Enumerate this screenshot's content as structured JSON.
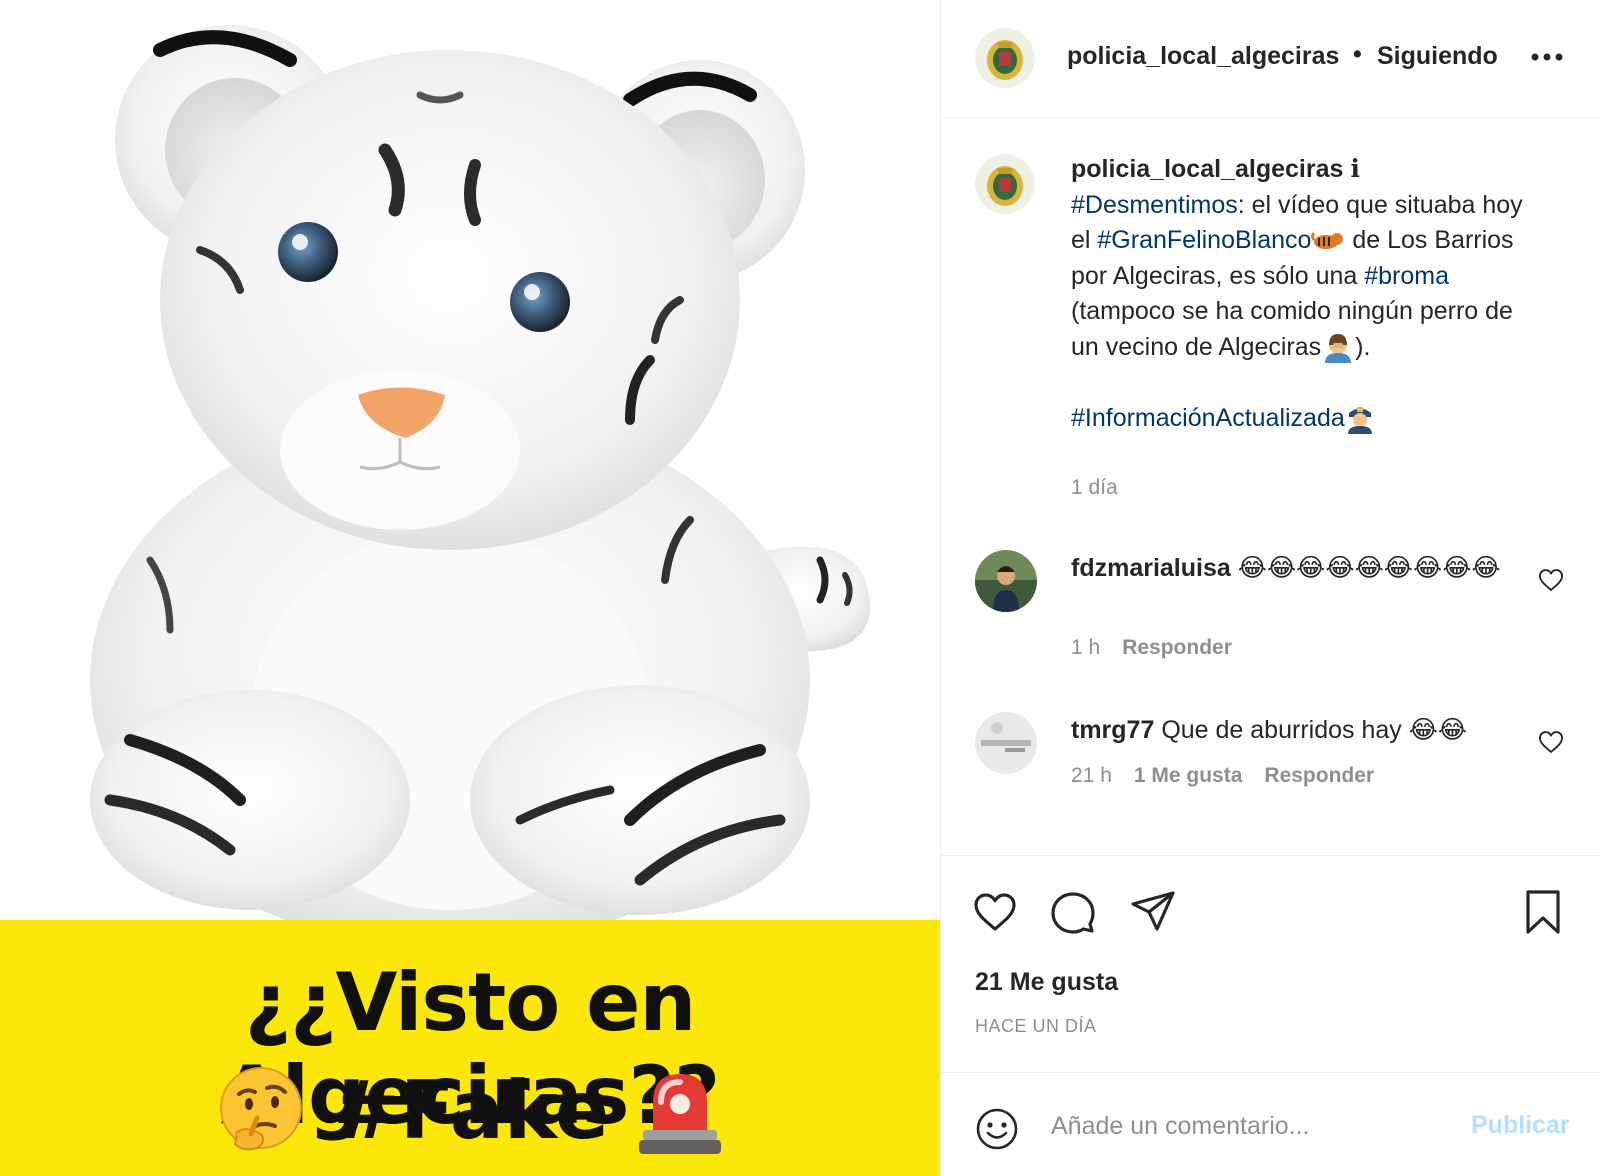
{
  "post": {
    "banner_line1": "¿¿Visto en Algeciras??",
    "banner_tag": "#Fake",
    "banner_emojis": [
      "thinking-face-emoji",
      "police-siren-emoji"
    ],
    "banner_color": "#fbe70a"
  },
  "header": {
    "username": "policia_local_algeciras",
    "separator": "•",
    "follow_label": "Siguiendo",
    "more_icon": "more-options-icon"
  },
  "caption": {
    "username": "policia_local_algeciras",
    "info_icon": "ℹ",
    "tag1": "#Desmentimos",
    "text1": ": el vídeo que situaba hoy el ",
    "tag2": "#GranFelinoBlanco",
    "text2": " de Los Barrios por Algeciras, es sólo una ",
    "tag3": "#broma",
    "text3": " (tampoco se ha comido ningún perro de un vecino de Algeciras",
    "text4": ").",
    "tag4": "#InformaciónActualizada",
    "time": "1 día",
    "hashtag_color": "#00376b"
  },
  "comments": [
    {
      "username": "fdzmarialuisa",
      "text": "😂😂😂😂😂😂😂😂😂",
      "time": "1 h",
      "reply_label": "Responder"
    },
    {
      "username": "tmrg77",
      "text": "Que de aburridos hay 😂😂",
      "time": "21 h",
      "likes_label": "1 Me gusta",
      "reply_label": "Responder"
    }
  ],
  "actions": {
    "icons": [
      "heart-icon",
      "comment-icon",
      "share-icon",
      "bookmark-icon"
    ],
    "likes": "21 Me gusta",
    "date": "HACE UN DÍA"
  },
  "composer": {
    "placeholder": "Añade un comentario...",
    "publish_label": "Publicar",
    "publish_color": "#b2dffc"
  }
}
